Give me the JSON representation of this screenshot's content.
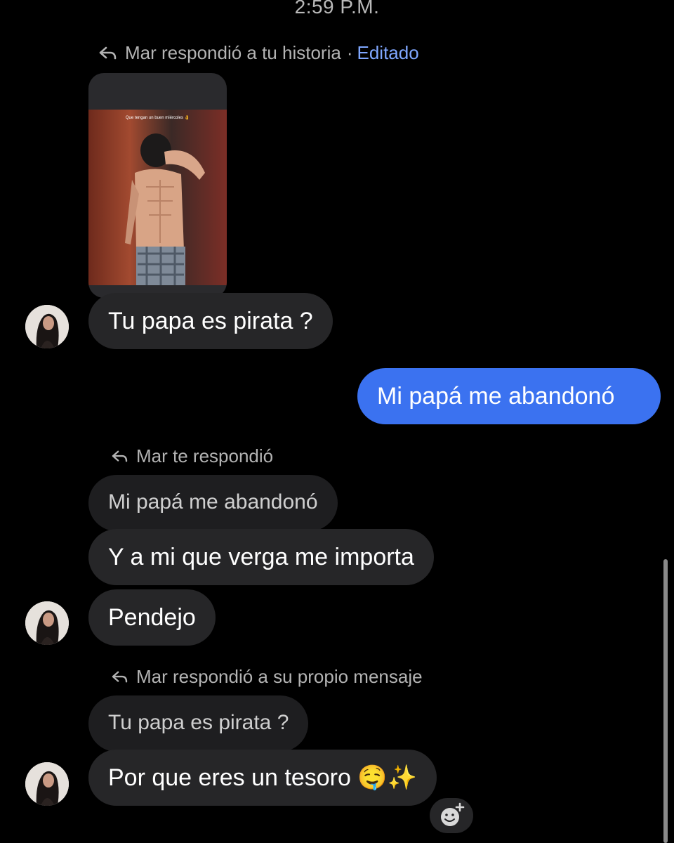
{
  "header": {
    "timestamp": "2:59 P.M."
  },
  "thread": {
    "story_reply": {
      "label": "Mar respondió a tu historia",
      "separator": "·",
      "edited": "Editado",
      "story_caption": "Que tengan un buen miércoles 👌"
    },
    "messages": [
      {
        "text": "Tu papa es pirata ?"
      },
      {
        "text": "Mi papá me abandonó"
      },
      {
        "reply_label": "Mar te respondió",
        "quoted": "Mi papá me abandonó",
        "text": "Y a mi que verga me importa"
      },
      {
        "text": "Pendejo"
      },
      {
        "reply_label": "Mar respondió a su propio mensaje",
        "quoted": "Tu papa es pirata ?",
        "text": "Por que eres un tesoro 🤤✨"
      }
    ]
  },
  "colors": {
    "background": "#000000",
    "incoming_bubble": "#262628",
    "outgoing_bubble": "#3b72f0",
    "edited_link": "#7fa7ff"
  },
  "icons": {
    "reply": "reply-arrow-icon",
    "add_reaction": "add-reaction-icon"
  }
}
